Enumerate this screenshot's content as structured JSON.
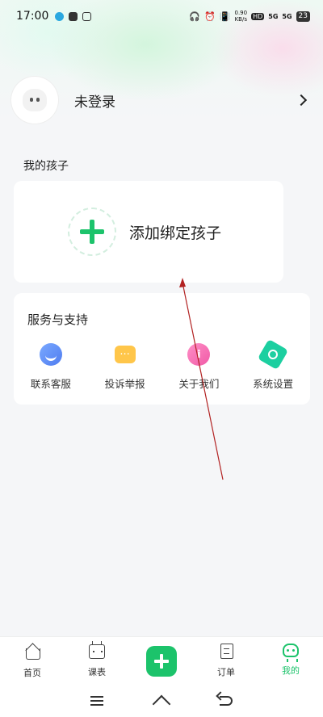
{
  "status_bar": {
    "time": "17:00",
    "net_speed_value": "0.90",
    "net_speed_unit": "KB/s",
    "hd_label": "HD",
    "signal1": "5G",
    "signal2": "5G",
    "battery": "23"
  },
  "profile": {
    "name": "未登录"
  },
  "kids": {
    "section_title": "我的孩子",
    "add_label": "添加绑定孩子"
  },
  "services": {
    "title": "服务与支持",
    "items": [
      {
        "label": "联系客服",
        "icon": "headset-icon"
      },
      {
        "label": "投诉举报",
        "icon": "chat-report-icon"
      },
      {
        "label": "关于我们",
        "icon": "info-icon"
      },
      {
        "label": "系统设置",
        "icon": "settings-icon"
      }
    ]
  },
  "tab_bar": {
    "items": [
      {
        "label": "首页",
        "icon": "home-icon"
      },
      {
        "label": "课表",
        "icon": "calendar-icon"
      },
      {
        "label": "",
        "icon": "plus-icon"
      },
      {
        "label": "订单",
        "icon": "receipt-icon"
      },
      {
        "label": "我的",
        "icon": "robot-icon",
        "active": true
      }
    ]
  },
  "colors": {
    "accent": "#1cc36b",
    "background": "#f5f6f8",
    "annotation_arrow": "#b22222"
  }
}
